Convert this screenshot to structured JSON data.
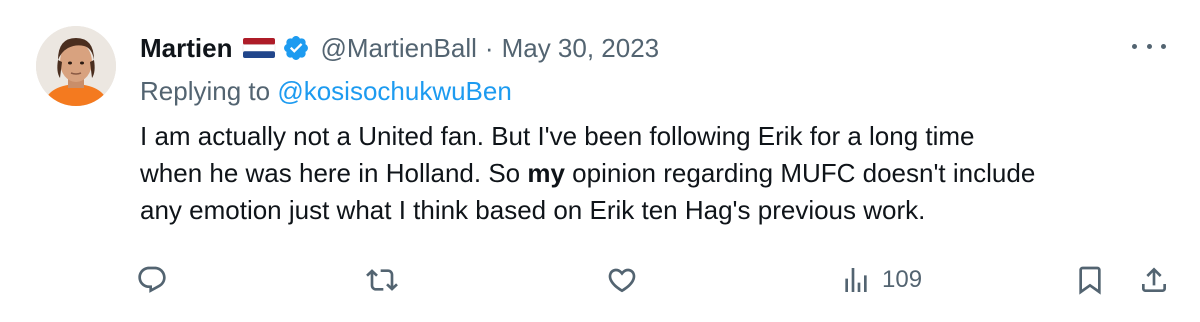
{
  "tweet": {
    "author": {
      "display_name": "Martien",
      "handle": "@MartienBall",
      "flag_icon": "netherlands-flag-icon",
      "verified_icon": "verified-badge-icon"
    },
    "separator": "·",
    "date": "May 30, 2023",
    "replying_prefix": "Replying to",
    "replying_to": "@kosisochukwuBen",
    "body_line1": "I am actually not a United fan. But I've been following Erik for a long time",
    "body_line2_before": "when he was here in Holland. So ",
    "body_line2_bold": "my",
    "body_line2_after": " opinion regarding MUFC doesn't include",
    "body_line3": "any emotion just what I think based on Erik ten Hag's previous work.",
    "views": "109"
  },
  "colors": {
    "text": "#0f1419",
    "secondary": "#536471",
    "link": "#1d9bf0",
    "verified": "#1d9bf0"
  },
  "icons": {
    "reply": "reply-icon",
    "retweet": "retweet-icon",
    "like": "like-icon",
    "views": "views-icon",
    "bookmark": "bookmark-icon",
    "share": "share-icon",
    "more": "more-icon"
  }
}
